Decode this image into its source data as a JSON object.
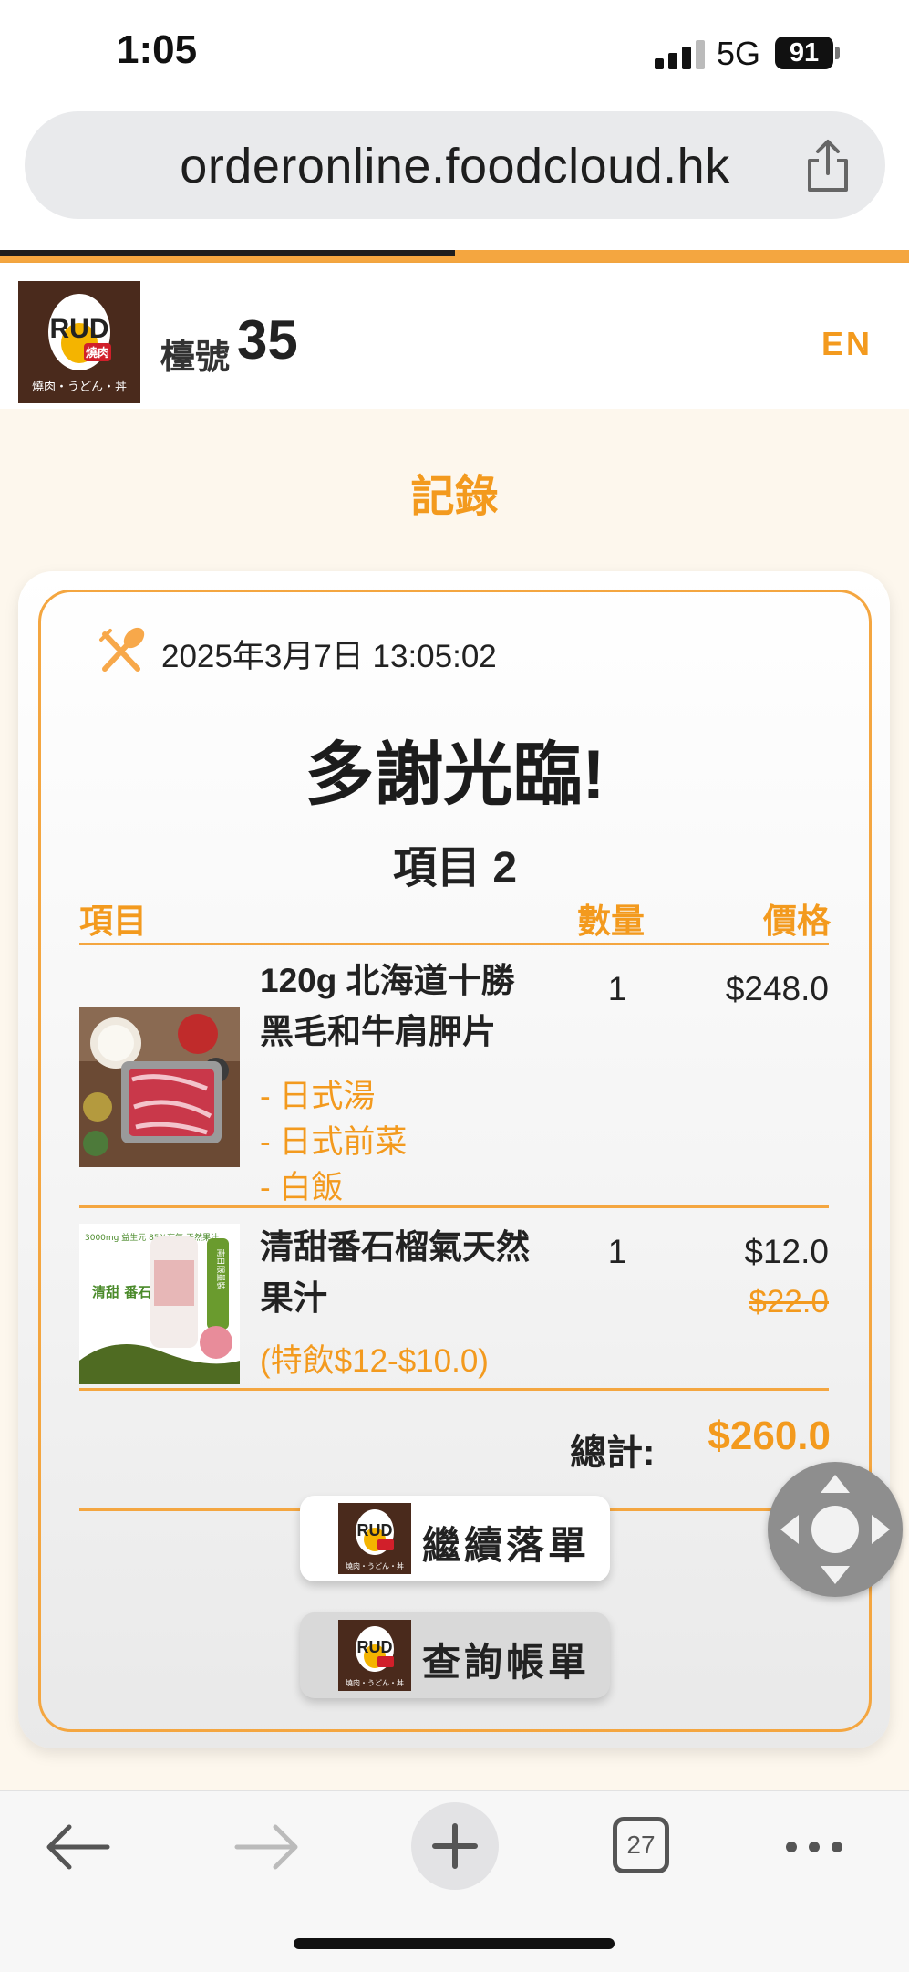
{
  "status_bar": {
    "time": "1:05",
    "network": "5G",
    "battery": "91"
  },
  "browser": {
    "url": "orderonline.foodcloud.hk",
    "load_progress": 0.5,
    "tab_count": "27"
  },
  "header": {
    "logo_text": "RUD",
    "logo_tag": "燒肉",
    "logo_sub": "燒肉・うどん・丼",
    "table_label": "檯號",
    "table_number": "35",
    "language_toggle": "EN"
  },
  "page": {
    "title": "記錄",
    "order_time": "2025年3月7日 13:05:02",
    "thanks": "多謝光臨!",
    "item_count_label": "項目",
    "item_count": "2",
    "columns": {
      "item": "項目",
      "qty": "數量",
      "price": "價格"
    },
    "items": [
      {
        "name": "120g 北海道十勝黑毛和牛肩胛片",
        "options": [
          "- 日式湯",
          "- 日式前菜",
          "- 白飯"
        ],
        "qty": "1",
        "price": "$248.0"
      },
      {
        "name": "清甜番石榴氣天然果汁",
        "note": "(特飲$12-$10.0)",
        "qty": "1",
        "price": "$12.0",
        "original_price": "$22.0",
        "image_text": {
          "top": "3000mg 益生元 85%有氣 天然果汁",
          "main": "清甜 番石榴",
          "badge": "南日限量裝"
        }
      }
    ],
    "total_label": "總計:",
    "total": "$260.0",
    "buttons": {
      "continue": "繼續落單",
      "bill": "查詢帳單"
    }
  },
  "colors": {
    "accent": "#f39a1e",
    "brand_brown": "#4a2a1c"
  }
}
